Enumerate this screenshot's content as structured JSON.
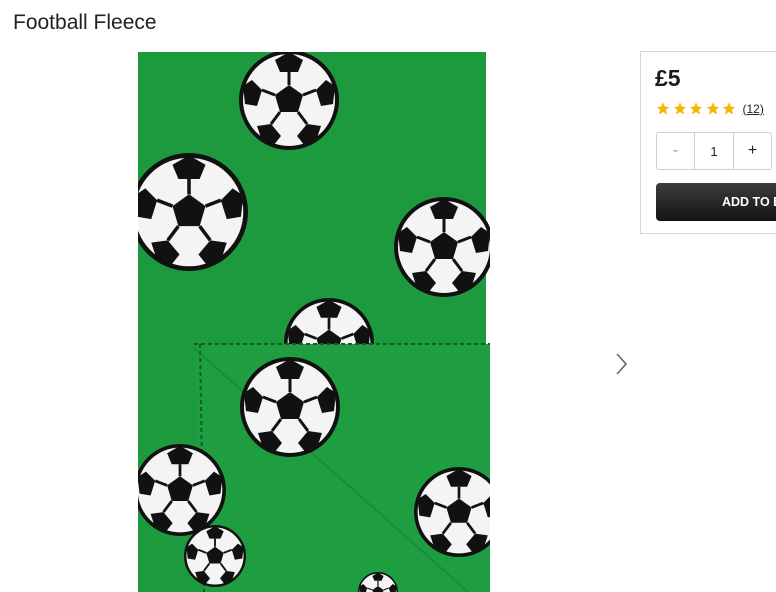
{
  "product": {
    "title": "Football Fleece",
    "image_alt": "Green fleece blanket with football print"
  },
  "gallery": {
    "next_icon": "chevron-right-icon"
  },
  "buy_box": {
    "price": "£5",
    "rating": 5,
    "rating_max": 5,
    "star_color": "#f5b700",
    "review_count": "(12)",
    "quantity": {
      "minus_label": "-",
      "value": "1",
      "plus_label": "+"
    },
    "add_to_bag_label": "ADD TO BAG"
  },
  "colors": {
    "fleece_green": "#1e9a3e",
    "button_dark": "#1f1f1f"
  }
}
